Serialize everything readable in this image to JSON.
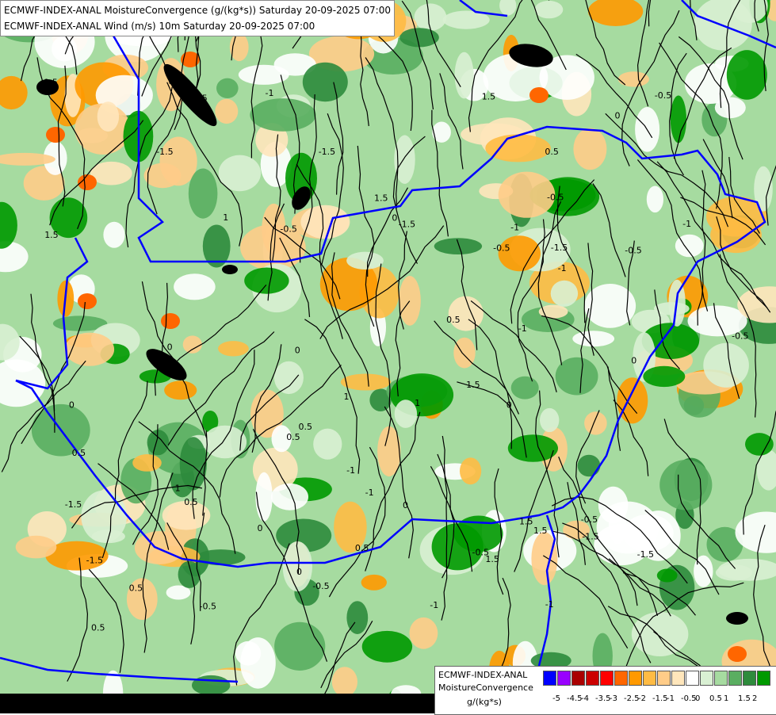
{
  "title_lines": [
    "ECMWF-INDEX-ANAL MoistureConvergence (g/(kg*s)) Saturday 20-09-2025 07:00",
    "ECMWF-INDEX-ANAL Wind (m/s) 10m Saturday 20-09-2025 07:00"
  ],
  "map_labels": [
    "0.5",
    "0",
    "-0.5",
    "1",
    "-1",
    "1.5",
    "-1.5"
  ],
  "legend": {
    "line1": "ECMWF-INDEX-ANAL",
    "line2": "MoistureConvergence",
    "line3": "g/(kg*s)",
    "colors": [
      "#0000ff",
      "#9900ff",
      "#aa0000",
      "#cc0000",
      "#ff0000",
      "#ff6600",
      "#ff9900",
      "#ffbb44",
      "#ffcc88",
      "#ffe6bb",
      "#ffffff",
      "#d9f0d3",
      "#a6dba0",
      "#5aae61",
      "#2e8b3c",
      "#009900"
    ],
    "ticks": [
      "-5",
      "-4.5",
      "-4",
      "-3.5",
      "-3",
      "-2.5",
      "-2",
      "-1.5",
      "-1",
      "-0.5",
      "0",
      "0.5",
      "1",
      "1.5",
      "2"
    ]
  }
}
